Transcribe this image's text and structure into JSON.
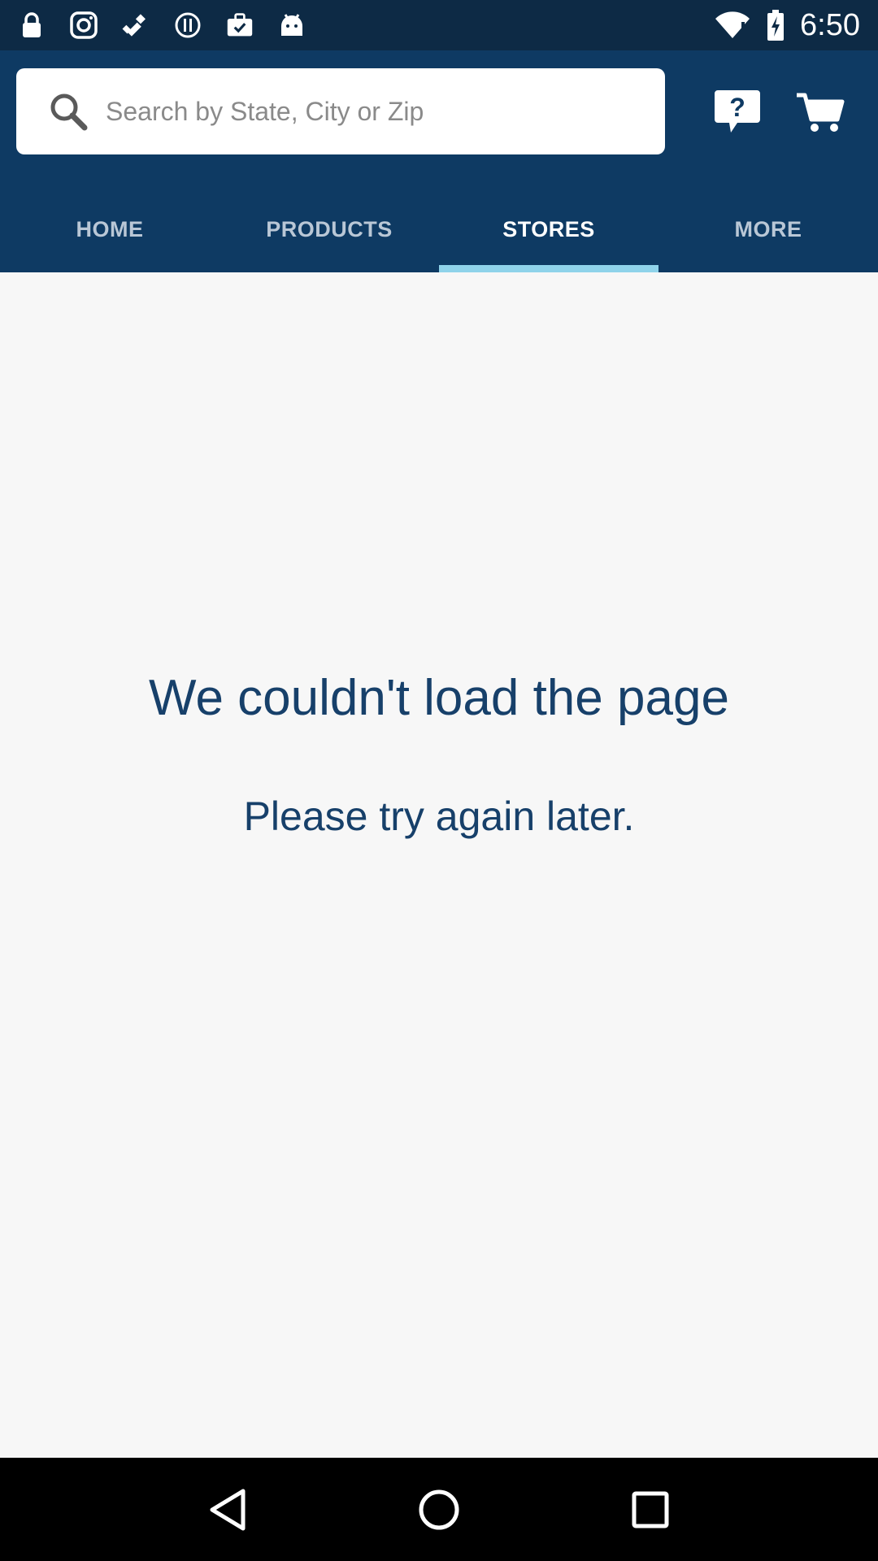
{
  "status_bar": {
    "time": "6:50",
    "icons": [
      "lock-icon",
      "instagram-icon",
      "fake-gps-icon",
      "info-icon",
      "briefcase-check-icon",
      "android-icon"
    ],
    "right_icons": [
      "wifi-alert-icon",
      "battery-charging-icon"
    ]
  },
  "header": {
    "search": {
      "placeholder": "Search by State, City or Zip",
      "value": ""
    },
    "help_icon": "help-chat-icon",
    "cart_icon": "cart-icon"
  },
  "tabs": [
    {
      "label": "HOME",
      "active": false
    },
    {
      "label": "PRODUCTS",
      "active": false
    },
    {
      "label": "STORES",
      "active": true
    },
    {
      "label": "MORE",
      "active": false
    }
  ],
  "content": {
    "title": "We couldn't load the page",
    "subtitle": "Please try again later."
  },
  "nav": {
    "icons": [
      "back-icon",
      "home-icon",
      "recents-icon"
    ]
  },
  "colors": {
    "status_bar": "#0d2a45",
    "header": "#0e3a63",
    "tab_indicator": "#8fd3ea",
    "text_primary": "#17406a"
  }
}
